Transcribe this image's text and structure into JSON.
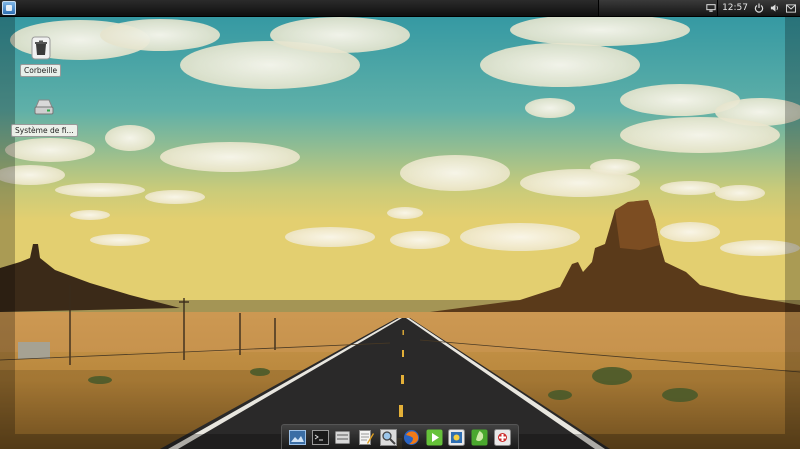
{
  "colors": {
    "sky_top": "#2f9aa6",
    "sky_bottom": "#d8c766",
    "ground": "#c28a3e",
    "road": "#2a2a2a",
    "panel": "#1a1a1a"
  },
  "topbar": {
    "menu_icon": "app-menu-icon",
    "tray": {
      "icons": [
        "display-icon",
        "power-icon",
        "volume-icon",
        "mail-icon"
      ],
      "clock": "12:57"
    }
  },
  "desktop": {
    "icons": [
      {
        "label": "Corbeille",
        "icon": "trash-icon"
      },
      {
        "label": "Système de fi...",
        "icon": "drive-icon"
      }
    ]
  },
  "dock": {
    "items": [
      {
        "icon": "desktop-icon"
      },
      {
        "icon": "terminal-icon"
      },
      {
        "icon": "file-manager-icon"
      },
      {
        "icon": "text-editor-icon"
      },
      {
        "icon": "search-icon"
      },
      {
        "icon": "firefox-icon"
      },
      {
        "icon": "media-player-icon"
      },
      {
        "icon": "image-viewer-icon"
      },
      {
        "icon": "software-center-icon"
      },
      {
        "icon": "settings-icon"
      }
    ]
  }
}
